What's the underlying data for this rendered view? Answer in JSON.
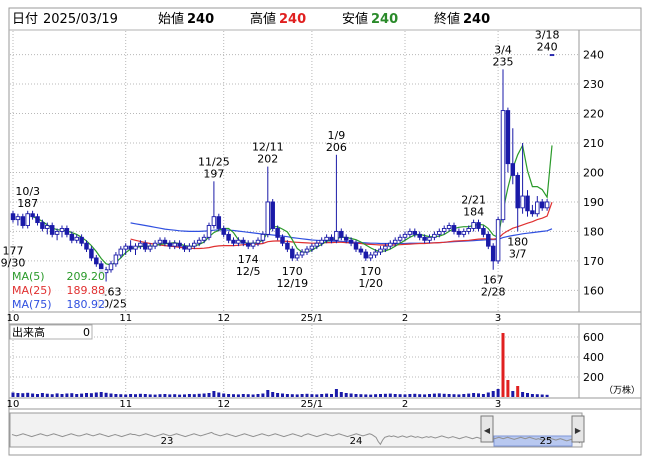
{
  "header": {
    "date_label": "日付",
    "date_value": "2025/03/19",
    "open_label": "始値",
    "open_value": "240",
    "high_label": "高値",
    "high_value": "240",
    "low_label": "安値",
    "low_value": "240",
    "close_label": "終値",
    "close_value": "240"
  },
  "colors": {
    "up": "#1a1aa8",
    "down": "#1a1aa8",
    "high_value": "#e02020",
    "low_value": "#2a8a2a",
    "ma5": "#2a9a2a",
    "ma25": "#e03030",
    "ma75": "#3050e0",
    "volume_normal": "#1a1aa8",
    "volume_up": "#e02020",
    "grid": "#b8b8b8",
    "scroll_track": "#e8e8e8",
    "scroll_thumb": "#b8c8f0"
  },
  "price_axis": {
    "ticks": [
      "240",
      "230",
      "220",
      "210",
      "200",
      "190",
      "180",
      "170",
      "160"
    ]
  },
  "volume_axis": {
    "label": "出来高",
    "current_value": "0",
    "ticks": [
      "600",
      "400",
      "200"
    ],
    "unit": "（万株）"
  },
  "legend": [
    {
      "name": "MA(5)",
      "value": "209.20"
    },
    {
      "name": "MA(25)",
      "value": "189.88"
    },
    {
      "name": "MA(75)",
      "value": "180.92"
    }
  ],
  "month_labels": [
    {
      "label": "10",
      "at": 0
    },
    {
      "label": "11",
      "at": 23
    },
    {
      "label": "12",
      "at": 43
    },
    {
      "label": "25/1",
      "at": 61
    },
    {
      "label": "2",
      "at": 80
    },
    {
      "label": "3",
      "at": 99
    }
  ],
  "annotations": [
    {
      "text": "10/3\n187",
      "at": 3,
      "value": 187,
      "pos": "above"
    },
    {
      "text": "177\n9/30",
      "at": 0,
      "value": 177,
      "pos": "below"
    },
    {
      "text": "163\n10/25",
      "at": 20,
      "value": 163,
      "pos": "below"
    },
    {
      "text": "11/25\n197",
      "at": 41,
      "value": 197,
      "pos": "above"
    },
    {
      "text": "174\n12/5",
      "at": 48,
      "value": 174,
      "pos": "below"
    },
    {
      "text": "12/11\n202",
      "at": 52,
      "value": 202,
      "pos": "above"
    },
    {
      "text": "170\n12/19",
      "at": 57,
      "value": 170,
      "pos": "below"
    },
    {
      "text": "1/9\n206",
      "at": 66,
      "value": 206,
      "pos": "above"
    },
    {
      "text": "170\n1/20",
      "at": 73,
      "value": 170,
      "pos": "below"
    },
    {
      "text": "2/21\n184",
      "at": 94,
      "value": 184,
      "pos": "above"
    },
    {
      "text": "167\n2/28",
      "at": 98,
      "value": 167,
      "pos": "below"
    },
    {
      "text": "3/4\n235",
      "at": 100,
      "value": 235,
      "pos": "above"
    },
    {
      "text": "180\n3/7",
      "at": 103,
      "value": 180,
      "pos": "below"
    },
    {
      "text": "3/18\n240",
      "at": 109,
      "value": 240,
      "pos": "above"
    }
  ],
  "scrollbar": {
    "left_arrow": "◀",
    "right_arrow": "▶",
    "year_labels": [
      "23",
      "24",
      "25"
    ]
  },
  "chart_data": {
    "type": "candlestick",
    "ylim": [
      153,
      248
    ],
    "days": 111,
    "ohlc": [
      [
        186,
        187,
        183,
        184
      ],
      [
        184,
        186,
        182,
        185
      ],
      [
        185,
        186,
        181,
        182
      ],
      [
        182,
        187,
        181,
        186
      ],
      [
        186,
        187,
        184,
        185
      ],
      [
        185,
        186,
        182,
        183
      ],
      [
        183,
        184,
        180,
        181
      ],
      [
        181,
        183,
        179,
        182
      ],
      [
        182,
        183,
        178,
        179
      ],
      [
        179,
        181,
        177,
        180
      ],
      [
        180,
        182,
        178,
        181
      ],
      [
        181,
        182,
        178,
        179
      ],
      [
        179,
        180,
        176,
        177
      ],
      [
        177,
        179,
        176,
        178
      ],
      [
        178,
        179,
        175,
        176
      ],
      [
        176,
        177,
        173,
        174
      ],
      [
        174,
        175,
        170,
        171
      ],
      [
        171,
        172,
        168,
        169
      ],
      [
        169,
        170,
        165,
        166
      ],
      [
        166,
        168,
        163,
        167
      ],
      [
        167,
        170,
        166,
        169
      ],
      [
        169,
        173,
        168,
        172
      ],
      [
        172,
        175,
        171,
        174
      ],
      [
        174,
        176,
        172,
        175
      ],
      [
        175,
        177,
        173,
        174
      ],
      [
        174,
        176,
        172,
        175
      ],
      [
        175,
        177,
        174,
        176
      ],
      [
        176,
        177,
        173,
        174
      ],
      [
        174,
        176,
        173,
        175
      ],
      [
        175,
        177,
        174,
        176
      ],
      [
        176,
        178,
        175,
        177
      ],
      [
        177,
        178,
        175,
        176
      ],
      [
        176,
        177,
        174,
        175
      ],
      [
        175,
        177,
        174,
        176
      ],
      [
        176,
        177,
        174,
        175
      ],
      [
        175,
        176,
        173,
        174
      ],
      [
        174,
        176,
        173,
        175
      ],
      [
        175,
        177,
        174,
        176
      ],
      [
        176,
        178,
        175,
        177
      ],
      [
        177,
        179,
        176,
        178
      ],
      [
        178,
        183,
        177,
        182
      ],
      [
        182,
        197,
        181,
        185
      ],
      [
        185,
        186,
        180,
        181
      ],
      [
        181,
        182,
        178,
        179
      ],
      [
        179,
        180,
        176,
        177
      ],
      [
        177,
        178,
        175,
        176
      ],
      [
        176,
        178,
        175,
        177
      ],
      [
        177,
        178,
        175,
        176
      ],
      [
        176,
        177,
        174,
        175
      ],
      [
        175,
        177,
        174,
        176
      ],
      [
        176,
        178,
        175,
        177
      ],
      [
        177,
        180,
        176,
        179
      ],
      [
        179,
        202,
        178,
        190
      ],
      [
        190,
        191,
        180,
        181
      ],
      [
        181,
        182,
        177,
        178
      ],
      [
        178,
        179,
        175,
        176
      ],
      [
        176,
        177,
        173,
        174
      ],
      [
        174,
        175,
        170,
        171
      ],
      [
        171,
        173,
        170,
        172
      ],
      [
        172,
        174,
        171,
        173
      ],
      [
        173,
        175,
        172,
        174
      ],
      [
        174,
        176,
        173,
        175
      ],
      [
        175,
        177,
        174,
        176
      ],
      [
        176,
        178,
        175,
        177
      ],
      [
        177,
        179,
        176,
        178
      ],
      [
        178,
        179,
        176,
        177
      ],
      [
        177,
        206,
        176,
        180
      ],
      [
        180,
        181,
        177,
        178
      ],
      [
        178,
        179,
        176,
        177
      ],
      [
        177,
        178,
        175,
        176
      ],
      [
        176,
        177,
        173,
        174
      ],
      [
        174,
        175,
        172,
        173
      ],
      [
        173,
        174,
        170,
        171
      ],
      [
        171,
        173,
        170,
        172
      ],
      [
        172,
        174,
        171,
        173
      ],
      [
        173,
        175,
        172,
        174
      ],
      [
        174,
        176,
        173,
        175
      ],
      [
        175,
        177,
        174,
        176
      ],
      [
        176,
        178,
        175,
        177
      ],
      [
        177,
        179,
        176,
        178
      ],
      [
        178,
        180,
        177,
        179
      ],
      [
        179,
        181,
        178,
        180
      ],
      [
        180,
        181,
        178,
        179
      ],
      [
        179,
        180,
        177,
        178
      ],
      [
        178,
        179,
        176,
        177
      ],
      [
        177,
        179,
        176,
        178
      ],
      [
        178,
        180,
        177,
        179
      ],
      [
        179,
        181,
        178,
        180
      ],
      [
        180,
        182,
        179,
        181
      ],
      [
        181,
        183,
        180,
        182
      ],
      [
        182,
        183,
        179,
        180
      ],
      [
        180,
        181,
        178,
        179
      ],
      [
        179,
        181,
        178,
        180
      ],
      [
        180,
        182,
        179,
        181
      ],
      [
        181,
        184,
        180,
        183
      ],
      [
        183,
        184,
        180,
        181
      ],
      [
        181,
        182,
        178,
        179
      ],
      [
        179,
        180,
        174,
        175
      ],
      [
        175,
        176,
        167,
        170
      ],
      [
        170,
        185,
        169,
        184
      ],
      [
        184,
        235,
        183,
        221
      ],
      [
        221,
        222,
        200,
        203
      ],
      [
        203,
        215,
        196,
        199
      ],
      [
        199,
        200,
        180,
        188
      ],
      [
        188,
        210,
        186,
        192
      ],
      [
        192,
        194,
        185,
        187
      ],
      [
        187,
        189,
        185,
        186
      ],
      [
        186,
        192,
        185,
        190
      ],
      [
        190,
        191,
        187,
        188
      ],
      [
        188,
        191,
        187,
        190
      ],
      [
        240,
        240,
        240,
        240
      ]
    ],
    "volume": [
      45,
      40,
      38,
      42,
      35,
      30,
      40,
      33,
      28,
      36,
      30,
      35,
      38,
      30,
      34,
      40,
      38,
      45,
      50,
      42,
      35,
      30,
      28,
      25,
      30,
      28,
      32,
      30,
      26,
      24,
      28,
      30,
      26,
      28,
      24,
      26,
      30,
      28,
      32,
      35,
      40,
      60,
      45,
      35,
      30,
      28,
      26,
      30,
      28,
      25,
      30,
      35,
      70,
      50,
      40,
      35,
      30,
      28,
      26,
      30,
      32,
      28,
      26,
      30,
      34,
      30,
      80,
      50,
      40,
      35,
      30,
      28,
      26,
      24,
      28,
      30,
      32,
      34,
      30,
      28,
      26,
      30,
      32,
      28,
      26,
      30,
      34,
      36,
      32,
      30,
      28,
      26,
      30,
      34,
      40,
      36,
      30,
      45,
      60,
      80,
      640,
      170,
      60,
      110,
      50,
      40,
      30,
      28,
      25,
      22,
      0
    ],
    "ma5": [
      null,
      null,
      null,
      null,
      185.0,
      184.4,
      183.4,
      182.2,
      181.2,
      180.6,
      180.4,
      180.2,
      179.6,
      179.0,
      178.0,
      176.8,
      175.2,
      173.2,
      170.8,
      169.0,
      168.6,
      169.6,
      171.0,
      172.8,
      174.0,
      174.6,
      174.8,
      175.0,
      175.0,
      175.2,
      175.6,
      175.8,
      176.0,
      176.2,
      175.8,
      175.2,
      175.0,
      175.0,
      175.6,
      176.4,
      178.2,
      179.6,
      180.4,
      181.0,
      181.0,
      179.6,
      177.2,
      176.2,
      176.0,
      176.0,
      176.2,
      177.0,
      179.8,
      181.6,
      181.6,
      180.8,
      179.8,
      177.2,
      174.2,
      173.0,
      173.0,
      173.6,
      174.6,
      175.6,
      176.6,
      177.2,
      177.6,
      178.0,
      178.0,
      177.6,
      177.2,
      176.4,
      175.4,
      174.4,
      173.6,
      173.2,
      173.4,
      174.0,
      175.0,
      176.0,
      177.0,
      178.0,
      178.8,
      179.0,
      178.6,
      178.2,
      178.2,
      178.4,
      179.0,
      180.0,
      181.0,
      181.4,
      181.6,
      181.6,
      182.0,
      182.4,
      182.2,
      181.0,
      178.8,
      178.0,
      187.0,
      194.8,
      201.4,
      206.0,
      209.2,
      200.6,
      195.2,
      195.2,
      194.2,
      191.6,
      209.2
    ],
    "ma25": [
      null,
      null,
      null,
      null,
      null,
      null,
      null,
      null,
      null,
      null,
      null,
      null,
      null,
      null,
      null,
      null,
      null,
      null,
      null,
      null,
      null,
      null,
      null,
      null,
      177.4,
      177.0,
      176.6,
      176.2,
      175.9,
      175.6,
      175.4,
      175.2,
      175.0,
      174.8,
      174.6,
      174.4,
      174.3,
      174.2,
      174.2,
      174.3,
      174.5,
      174.9,
      175.1,
      175.2,
      175.2,
      175.2,
      175.3,
      175.5,
      175.6,
      175.6,
      175.7,
      175.9,
      176.5,
      176.7,
      176.8,
      176.7,
      176.6,
      176.4,
      176.3,
      176.2,
      176.1,
      176.0,
      176.0,
      176.1,
      176.2,
      176.2,
      176.3,
      176.3,
      176.2,
      176.1,
      176.0,
      175.9,
      175.7,
      175.6,
      175.5,
      175.4,
      175.4,
      175.4,
      175.4,
      175.5,
      175.6,
      175.7,
      175.8,
      175.9,
      175.9,
      176.0,
      176.1,
      176.2,
      176.3,
      176.5,
      176.7,
      176.8,
      176.9,
      177.0,
      177.2,
      177.4,
      177.5,
      177.5,
      177.4,
      177.6,
      179.2,
      180.2,
      181.1,
      181.6,
      182.2,
      182.8,
      183.3,
      184.0,
      184.5,
      185.2,
      189.9
    ],
    "ma75": [
      null,
      null,
      null,
      null,
      null,
      null,
      null,
      null,
      null,
      null,
      null,
      null,
      null,
      null,
      null,
      null,
      null,
      null,
      null,
      null,
      null,
      null,
      null,
      null,
      182.9,
      182.6,
      182.3,
      182.0,
      181.7,
      181.4,
      181.1,
      180.8,
      180.6,
      180.4,
      180.2,
      180.1,
      180.0,
      180.0,
      180.0,
      180.1,
      180.2,
      180.4,
      180.5,
      180.5,
      180.4,
      180.3,
      180.1,
      179.9,
      179.7,
      179.5,
      179.3,
      179.1,
      179.0,
      178.8,
      178.6,
      178.4,
      178.2,
      177.9,
      177.7,
      177.5,
      177.3,
      177.1,
      177.0,
      176.9,
      176.8,
      176.7,
      176.7,
      176.6,
      176.5,
      176.4,
      176.3,
      176.2,
      176.1,
      176.0,
      176.0,
      175.9,
      175.9,
      175.9,
      175.9,
      175.9,
      175.9,
      176.0,
      176.0,
      176.0,
      176.0,
      176.1,
      176.1,
      176.2,
      176.3,
      176.4,
      176.5,
      176.6,
      176.7,
      176.8,
      176.9,
      177.0,
      177.1,
      177.2,
      177.2,
      177.3,
      177.9,
      178.3,
      178.6,
      178.9,
      179.2,
      179.4,
      179.6,
      179.8,
      180.0,
      180.2,
      180.9
    ],
    "scroll_overview": [
      40,
      39,
      38,
      39,
      40,
      41,
      40,
      39,
      38,
      37,
      38,
      39,
      40,
      41,
      40,
      39,
      38,
      39,
      40,
      41,
      40,
      39,
      38,
      37,
      38,
      39,
      40,
      41,
      40,
      39,
      38,
      38,
      39,
      40,
      41,
      40,
      39,
      38,
      39,
      40,
      41,
      40,
      39,
      38,
      37,
      38,
      39,
      40,
      39,
      38,
      37,
      38,
      39,
      40,
      41,
      40,
      40,
      39,
      38,
      39,
      40,
      41,
      40,
      39,
      38,
      37,
      38,
      39,
      40,
      41,
      40,
      39,
      38,
      39,
      40,
      41,
      40,
      39,
      38,
      37,
      38,
      39,
      40,
      41,
      40,
      39,
      38,
      39,
      40,
      41,
      42,
      43,
      41,
      40,
      39,
      38,
      39,
      40,
      41,
      40,
      39,
      38,
      37,
      38,
      39,
      40,
      41,
      40,
      39,
      38,
      37,
      38,
      39,
      40,
      41,
      40,
      39,
      38,
      39,
      40,
      41,
      40,
      39,
      38,
      37,
      38,
      39,
      40,
      41,
      40,
      39,
      38,
      37,
      39,
      40,
      41,
      40,
      39,
      38,
      37,
      38,
      39,
      40,
      41,
      40,
      39,
      38,
      39,
      40,
      41,
      40,
      39,
      38,
      37,
      38,
      39,
      40,
      41,
      40,
      39,
      38,
      39,
      40,
      41,
      40,
      38,
      36,
      30,
      26,
      32,
      36,
      37,
      38,
      37,
      38,
      37,
      36,
      37,
      38,
      37,
      36,
      37,
      38,
      37,
      36,
      37,
      36,
      35,
      36,
      37,
      36,
      37,
      36,
      35,
      36,
      37,
      38,
      37,
      36,
      35,
      36,
      37,
      36,
      35,
      34,
      35,
      36,
      37,
      36,
      35,
      34,
      35,
      36,
      35,
      34,
      35,
      36,
      35,
      34,
      33,
      34,
      35,
      36,
      35,
      34,
      35,
      36,
      35,
      34,
      33,
      34,
      35,
      36,
      35,
      34,
      35,
      36,
      35,
      34,
      33,
      34,
      33,
      32,
      33,
      34,
      35,
      34,
      33,
      32,
      33,
      34,
      33,
      32,
      31,
      32,
      33,
      32,
      31,
      30,
      28
    ]
  }
}
